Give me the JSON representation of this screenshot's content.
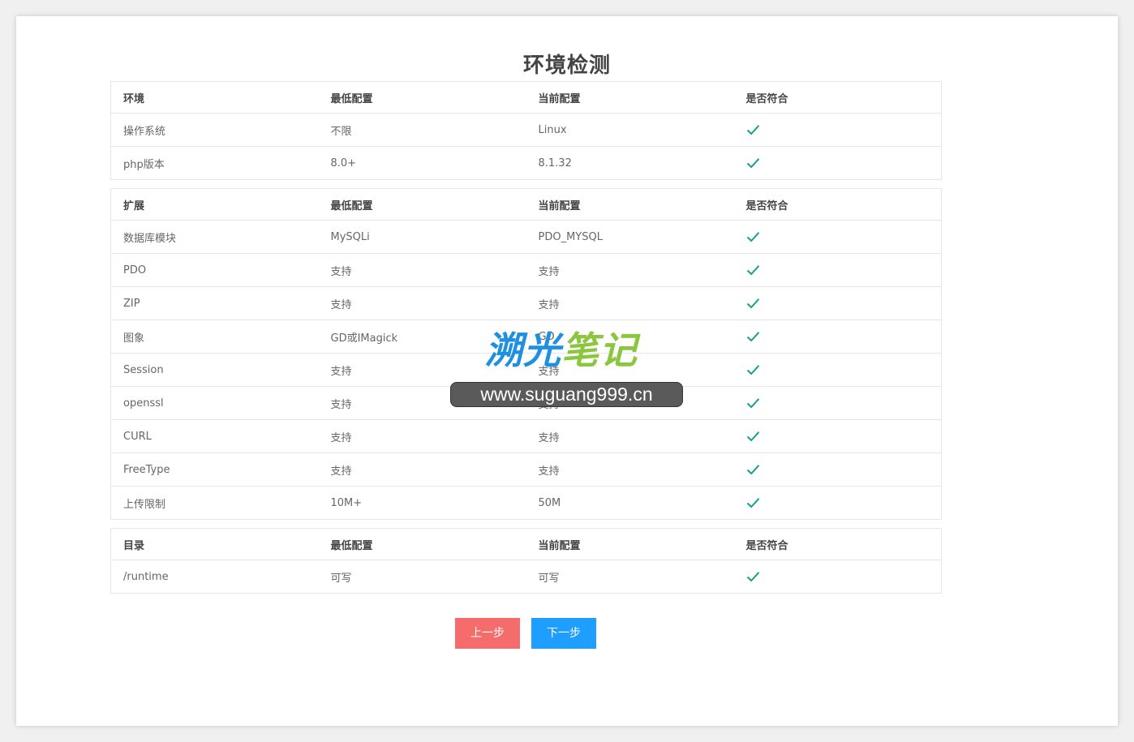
{
  "page": {
    "title": "环境检测"
  },
  "tables": [
    {
      "headers": [
        "环境",
        "最低配置",
        "当前配置",
        "是否符合"
      ],
      "rows": [
        [
          "操作系统",
          "不限",
          "Linux"
        ],
        [
          "php版本",
          "8.0+",
          "8.1.32"
        ]
      ]
    },
    {
      "headers": [
        "扩展",
        "最低配置",
        "当前配置",
        "是否符合"
      ],
      "rows": [
        [
          "数据库模块",
          "MySQLi",
          "PDO_MYSQL"
        ],
        [
          "PDO",
          "支持",
          "支持"
        ],
        [
          "ZIP",
          "支持",
          "支持"
        ],
        [
          "图象",
          "GD或IMagick",
          "GD"
        ],
        [
          "Session",
          "支持",
          "支持"
        ],
        [
          "openssl",
          "支持",
          "支持"
        ],
        [
          "CURL",
          "支持",
          "支持"
        ],
        [
          "FreeType",
          "支持",
          "支持"
        ],
        [
          "上传限制",
          "10M+",
          "50M"
        ]
      ]
    },
    {
      "headers": [
        "目录",
        "最低配置",
        "当前配置",
        "是否符合"
      ],
      "rows": [
        [
          "/runtime",
          "可写",
          "可写"
        ]
      ]
    }
  ],
  "status_icon": "check-icon",
  "colors": {
    "check": "#16a085",
    "prev_button": "#f56c6c",
    "next_button": "#1e9fff"
  },
  "buttons": {
    "prev": "上一步",
    "next": "下一步"
  },
  "watermark": {
    "logo_part1": "溯光",
    "logo_part2": "笔记",
    "url": "www.suguang999.cn"
  }
}
